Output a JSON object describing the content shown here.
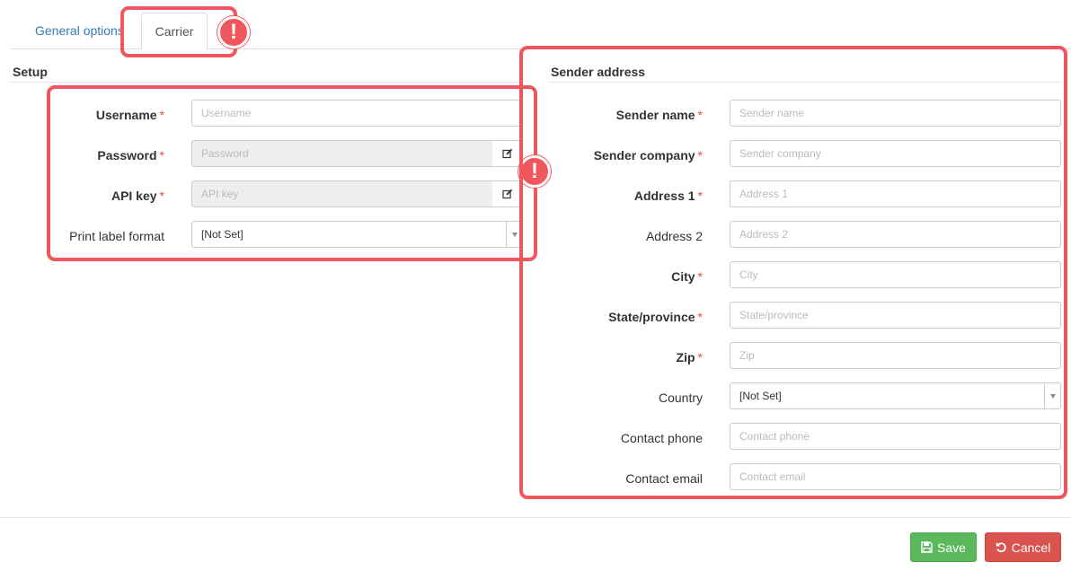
{
  "tabs": {
    "general_label": "General options",
    "carrier_label": "Carrier"
  },
  "setup": {
    "title": "Setup",
    "username": {
      "label": "Username",
      "placeholder": "Username",
      "required_mark": "*"
    },
    "password": {
      "label": "Password",
      "placeholder": "Password",
      "required_mark": "*"
    },
    "api_key": {
      "label": "API key",
      "placeholder": "API key",
      "required_mark": "*"
    },
    "print_label_format": {
      "label": "Print label format",
      "value": "[Not Set]"
    }
  },
  "sender": {
    "title": "Sender address",
    "sender_name": {
      "label": "Sender name",
      "placeholder": "Sender name",
      "required_mark": "*"
    },
    "sender_company": {
      "label": "Sender company",
      "placeholder": "Sender company",
      "required_mark": "*"
    },
    "address1": {
      "label": "Address 1",
      "placeholder": "Address 1",
      "required_mark": "*"
    },
    "address2": {
      "label": "Address 2",
      "placeholder": "Address 2"
    },
    "city": {
      "label": "City",
      "placeholder": "City",
      "required_mark": "*"
    },
    "state": {
      "label": "State/province",
      "placeholder": "State/province",
      "required_mark": "*"
    },
    "zip": {
      "label": "Zip",
      "placeholder": "Zip",
      "required_mark": "*"
    },
    "country": {
      "label": "Country",
      "value": "[Not Set]"
    },
    "contact_phone": {
      "label": "Contact phone",
      "placeholder": "Contact phone"
    },
    "contact_email": {
      "label": "Contact email",
      "placeholder": "Contact email"
    }
  },
  "footer": {
    "save_label": "Save",
    "cancel_label": "Cancel"
  },
  "alerts": {
    "badge_glyph": "!"
  },
  "colors": {
    "callout": "#f0575c",
    "link": "#337ab7",
    "required_star": "#e74c3c",
    "save_button": "#5cb85c",
    "cancel_button": "#d9534f"
  }
}
